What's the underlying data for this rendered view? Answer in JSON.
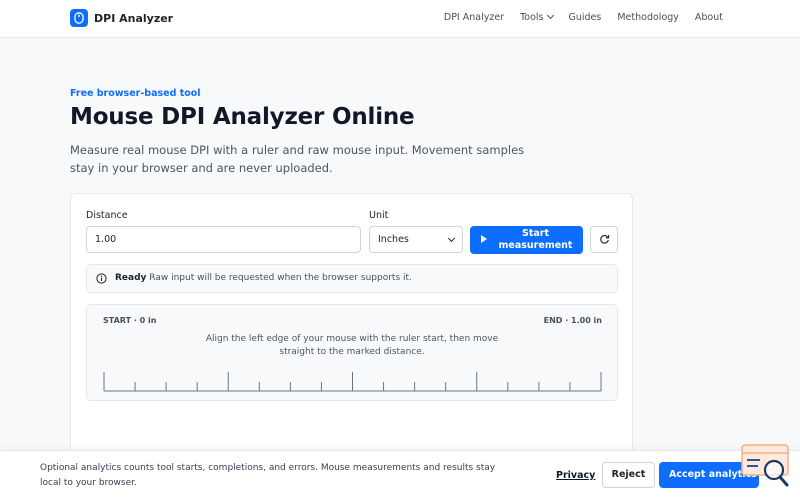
{
  "brand": {
    "name": "DPI Analyzer"
  },
  "nav": {
    "items": [
      {
        "label": "DPI Analyzer"
      },
      {
        "label": "Tools"
      },
      {
        "label": "Guides"
      },
      {
        "label": "Methodology"
      },
      {
        "label": "About"
      }
    ]
  },
  "hero": {
    "eyebrow": "Free browser-based tool",
    "title": "Mouse DPI Analyzer Online",
    "lead": "Measure real mouse DPI with a ruler and raw mouse input. Movement samples stay in your browser and are never uploaded."
  },
  "tool": {
    "distance_label": "Distance",
    "distance_value": "1.00",
    "unit_label": "Unit",
    "unit_value": "Inches",
    "start_label": "Start measurement",
    "status_strong": "Ready",
    "status_text": " Raw input will be requested when the browser supports it.",
    "ruler_start": "START · 0 in",
    "ruler_end": "END · 1.00 in",
    "ruler_instruction": "Align the left edge of your mouse with the ruler start, then move straight to the marked distance."
  },
  "cookie": {
    "text": "Optional analytics counts tool starts, completions, and errors. Mouse measurements and results stay local to your browser.",
    "privacy_label": "Privacy",
    "reject_label": "Reject",
    "accept_label": "Accept analytics"
  },
  "colors": {
    "accent": "#0d6efd",
    "text": "#111827",
    "muted": "#4b5563",
    "border": "#e5e7eb",
    "background": "#f8f9fa"
  }
}
